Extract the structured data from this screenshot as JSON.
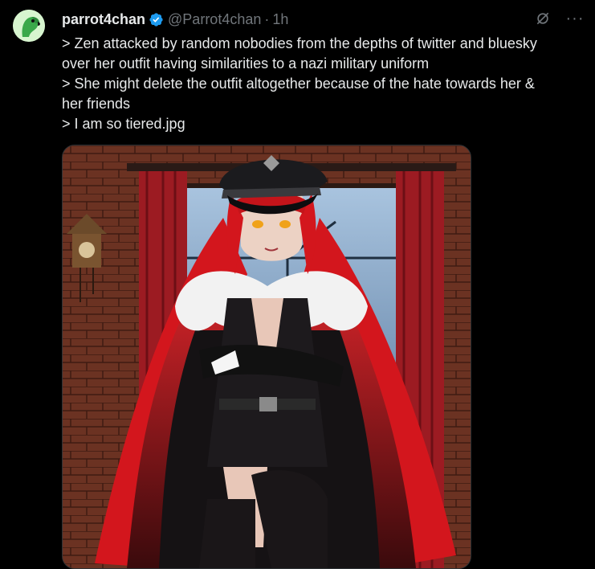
{
  "tweet": {
    "author": {
      "display_name": "parrot4chan",
      "handle": "@Parrot4chan",
      "avatar_icon": "parrot-avatar",
      "verified": true,
      "verified_color": "#1d9bf0"
    },
    "separator": "·",
    "time": "1h",
    "text_lines": [
      "> Zen attacked by random nobodies from the depths of twitter and bluesky",
      "over her outfit having similarities to a nazi military uniform",
      "> She might delete the outfit altogether because of the hate towards her &",
      "her friends",
      "> I am so tiered.jpg"
    ],
    "icons": {
      "grok": "grok-icon",
      "more": "more-options-icon",
      "more_glyph": "···"
    },
    "media": {
      "type": "image",
      "subject": "anime-character-illustration"
    },
    "colors": {
      "background": "#000000",
      "text": "#e7e9ea",
      "muted": "#71767b",
      "accent": "#1d9bf0"
    }
  }
}
